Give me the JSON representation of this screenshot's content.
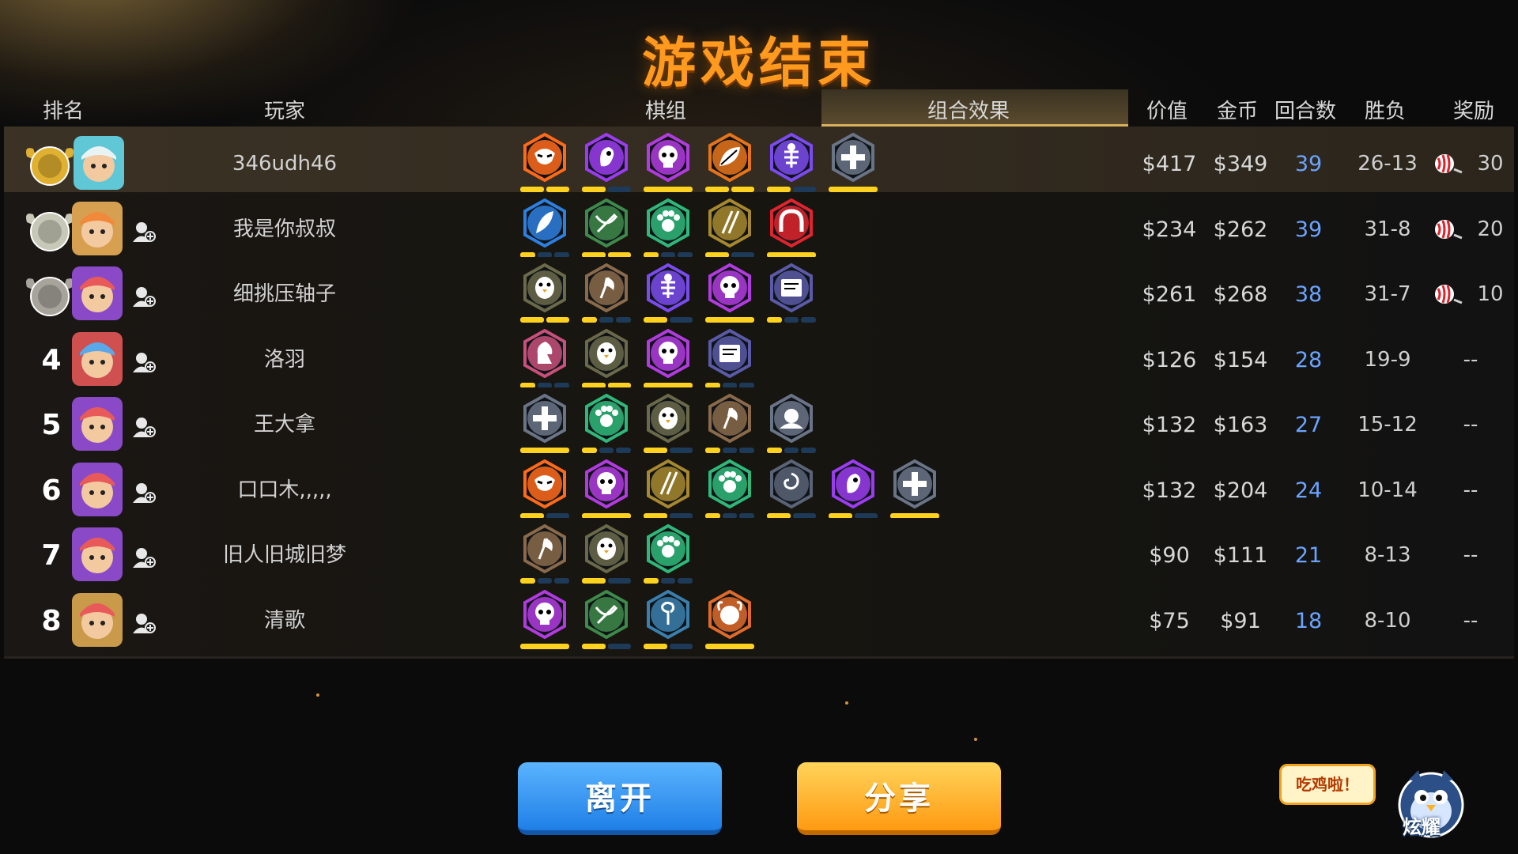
{
  "title": "游戏结束",
  "headers": {
    "rank": "排名",
    "player": "玩家",
    "board": "棋组",
    "combo": "组合效果",
    "value": "价值",
    "gold": "金币",
    "rounds": "回合数",
    "winloss": "胜负",
    "reward": "奖励"
  },
  "colors": {
    "accent": "#ff9a1f",
    "rounds": "#6ba4ff",
    "pip_on": "#ffd21f",
    "pip_off": "#1d3a58"
  },
  "players": [
    {
      "rank": "",
      "badge": "gold-medal",
      "avatar": "white-beast",
      "friend": false,
      "name": "346udh46",
      "value": "$417",
      "gold": "$349",
      "rounds": "39",
      "winloss": "26-13",
      "reward": "30",
      "traits": [
        {
          "icon": "demon-mask",
          "color": "#ff6a1a",
          "pips": [
            1,
            1
          ]
        },
        {
          "icon": "spirit",
          "color": "#9b3cf0",
          "pips": [
            1,
            0
          ]
        },
        {
          "icon": "skull",
          "color": "#b23be0",
          "pips": [
            1
          ]
        },
        {
          "icon": "leaf",
          "color": "#e8741a",
          "pips": [
            1,
            1
          ]
        },
        {
          "icon": "fish-bone",
          "color": "#7b4bf0",
          "pips": [
            1,
            0
          ]
        },
        {
          "icon": "cross",
          "color": "#6a7487",
          "pips": [
            1
          ]
        }
      ]
    },
    {
      "rank": "",
      "badge": "silver-medal",
      "avatar": "monkey-warrior",
      "friend": true,
      "name": "我是你叔叔",
      "value": "$234",
      "gold": "$262",
      "rounds": "39",
      "winloss": "31-8",
      "reward": "20",
      "traits": [
        {
          "icon": "feather",
          "color": "#2d7fe0",
          "pips": [
            1,
            0,
            0
          ]
        },
        {
          "icon": "crossbow",
          "color": "#3e8a4a",
          "pips": [
            1,
            1
          ]
        },
        {
          "icon": "paw",
          "color": "#2fb87a",
          "pips": [
            1,
            0,
            0
          ]
        },
        {
          "icon": "daggers",
          "color": "#a8882e",
          "pips": [
            1,
            0
          ]
        },
        {
          "icon": "horseshoe",
          "color": "#e0242e",
          "pips": [
            1
          ]
        }
      ]
    },
    {
      "rank": "",
      "badge": "bronze-medal",
      "avatar": "red-hair-boy",
      "friend": true,
      "name": "细挑压轴子",
      "value": "$261",
      "gold": "$268",
      "rounds": "38",
      "winloss": "31-7",
      "reward": "10",
      "traits": [
        {
          "icon": "penguin",
          "color": "#6a6a4a",
          "pips": [
            1,
            1
          ]
        },
        {
          "icon": "axe",
          "color": "#8a6a4a",
          "pips": [
            1,
            0,
            0
          ]
        },
        {
          "icon": "fish-bone",
          "color": "#7b4bf0",
          "pips": [
            1,
            0
          ]
        },
        {
          "icon": "skull",
          "color": "#b23be0",
          "pips": [
            1
          ]
        },
        {
          "icon": "spellbook",
          "color": "#5a5aa8",
          "pips": [
            1,
            0,
            0
          ]
        }
      ]
    },
    {
      "rank": "4",
      "badge": "",
      "avatar": "blue-bird",
      "friend": true,
      "name": "洛羽",
      "value": "$126",
      "gold": "$154",
      "rounds": "28",
      "winloss": "19-9",
      "reward": "--",
      "traits": [
        {
          "icon": "knight",
          "color": "#c8507a",
          "pips": [
            1,
            0,
            0
          ]
        },
        {
          "icon": "penguin",
          "color": "#6a6a4a",
          "pips": [
            1,
            1
          ]
        },
        {
          "icon": "skull",
          "color": "#b23be0",
          "pips": [
            1
          ]
        },
        {
          "icon": "spellbook",
          "color": "#5a5aa8",
          "pips": [
            1,
            0,
            0
          ]
        }
      ]
    },
    {
      "rank": "5",
      "badge": "",
      "avatar": "red-hair-boy",
      "friend": true,
      "name": "王大拿",
      "value": "$132",
      "gold": "$163",
      "rounds": "27",
      "winloss": "15-12",
      "reward": "--",
      "traits": [
        {
          "icon": "cross",
          "color": "#6a7487",
          "pips": [
            1
          ]
        },
        {
          "icon": "paw",
          "color": "#2fb87a",
          "pips": [
            1,
            0,
            0
          ]
        },
        {
          "icon": "penguin",
          "color": "#6a6a4a",
          "pips": [
            1,
            0
          ]
        },
        {
          "icon": "axe",
          "color": "#8a6a4a",
          "pips": [
            1,
            0,
            0
          ]
        },
        {
          "icon": "hood",
          "color": "#6a7487",
          "pips": [
            1,
            0,
            0
          ]
        }
      ]
    },
    {
      "rank": "6",
      "badge": "",
      "avatar": "red-hair-boy",
      "friend": true,
      "name": "口口木,,,,,",
      "value": "$132",
      "gold": "$204",
      "rounds": "24",
      "winloss": "10-14",
      "reward": "--",
      "traits": [
        {
          "icon": "demon-mask",
          "color": "#ff6a1a",
          "pips": [
            1,
            0
          ]
        },
        {
          "icon": "skull",
          "color": "#b23be0",
          "pips": [
            1
          ]
        },
        {
          "icon": "daggers",
          "color": "#a8882e",
          "pips": [
            1,
            0
          ]
        },
        {
          "icon": "paw",
          "color": "#2fb87a",
          "pips": [
            1,
            0,
            0
          ]
        },
        {
          "icon": "swirl",
          "color": "#5a6478",
          "pips": [
            1,
            0
          ]
        },
        {
          "icon": "spirit",
          "color": "#9b3cf0",
          "pips": [
            1,
            0
          ]
        },
        {
          "icon": "cross",
          "color": "#6a7487",
          "pips": [
            1
          ]
        }
      ]
    },
    {
      "rank": "7",
      "badge": "",
      "avatar": "red-hair-boy",
      "friend": true,
      "name": "旧人旧城旧梦",
      "value": "$90",
      "gold": "$111",
      "rounds": "21",
      "winloss": "8-13",
      "reward": "--",
      "traits": [
        {
          "icon": "axe",
          "color": "#8a6a4a",
          "pips": [
            1,
            0,
            0
          ]
        },
        {
          "icon": "penguin",
          "color": "#6a6a4a",
          "pips": [
            1,
            0
          ]
        },
        {
          "icon": "paw",
          "color": "#2fb87a",
          "pips": [
            1,
            0,
            0
          ]
        }
      ]
    },
    {
      "rank": "8",
      "badge": "",
      "avatar": "red-hair-framed",
      "friend": true,
      "name": "清歌",
      "value": "$75",
      "gold": "$91",
      "rounds": "18",
      "winloss": "8-10",
      "reward": "--",
      "traits": [
        {
          "icon": "skull",
          "color": "#b23be0",
          "pips": [
            1
          ]
        },
        {
          "icon": "crossbow",
          "color": "#3e8a4a",
          "pips": [
            1,
            0
          ]
        },
        {
          "icon": "hook",
          "color": "#3a7fae",
          "pips": [
            1,
            0
          ]
        },
        {
          "icon": "viking",
          "color": "#e06a2a",
          "pips": [
            1
          ]
        }
      ]
    }
  ],
  "buttons": {
    "leave": "离开",
    "share": "分享"
  },
  "bubble": "吃鸡啦！",
  "mascot_label": "炫耀"
}
